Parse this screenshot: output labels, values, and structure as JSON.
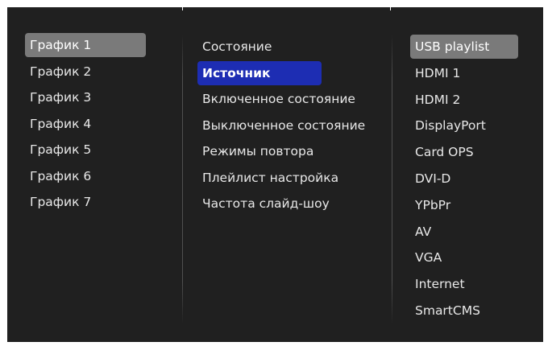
{
  "schedules": {
    "items": [
      "График 1",
      "График 2",
      "График 3",
      "График 4",
      "График 5",
      "График 6",
      "График 7"
    ],
    "selected_index": 0
  },
  "settings": {
    "items": [
      "Состояние",
      "Источник",
      "Включенное состояние",
      "Выключенное состояние",
      "Режимы повтора",
      "Плейлист настройка",
      "Частота слайд-шоу"
    ],
    "selected_index": 1
  },
  "sources": {
    "items": [
      "USB playlist",
      "HDMI 1",
      "HDMI 2",
      "DisplayPort",
      "Card OPS",
      "DVI-D",
      "YPbPr",
      "AV",
      "VGA",
      "Internet",
      "SmartCMS"
    ],
    "selected_index": 0
  },
  "colors": {
    "background": "#202020",
    "grey_highlight": "#7a7a7a",
    "blue_highlight": "#1d2db3",
    "text": "#e8e8e8"
  }
}
